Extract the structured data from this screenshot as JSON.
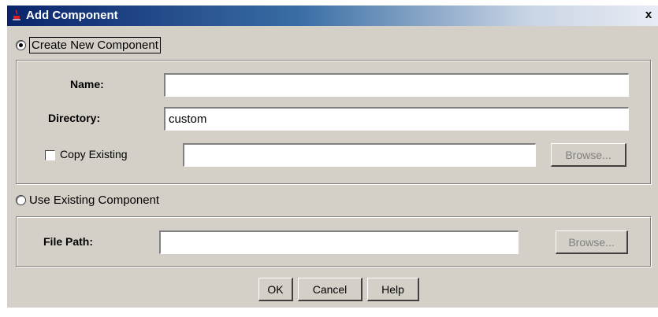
{
  "window": {
    "title": "Add Component",
    "close_glyph": "x"
  },
  "create_new": {
    "label": "Create New Component",
    "selected": true
  },
  "name": {
    "label": "Name:",
    "value": ""
  },
  "directory": {
    "label": "Directory:",
    "value": "custom"
  },
  "copy_existing": {
    "label": "Copy Existing",
    "checked": false,
    "value": "",
    "browse_label": "Browse..."
  },
  "use_existing": {
    "label": "Use Existing Component",
    "selected": false
  },
  "file_path": {
    "label": "File Path:",
    "value": "",
    "browse_label": "Browse..."
  },
  "buttons": {
    "ok": "OK",
    "cancel": "Cancel",
    "help": "Help"
  },
  "colors": {
    "titlebar_start": "#0a246a",
    "dialog_bg": "#d4d0c8"
  }
}
